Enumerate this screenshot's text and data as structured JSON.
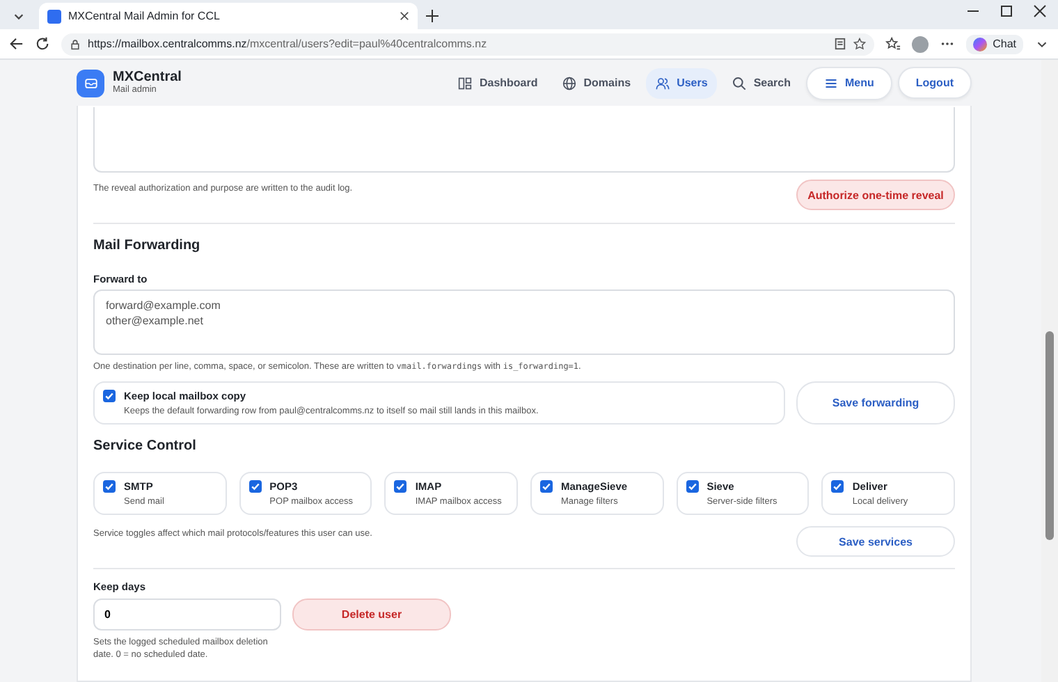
{
  "browser": {
    "tab_title": "MXCentral Mail Admin for CCL",
    "url_host": "https://mailbox.centralcomms.nz",
    "url_path": "/mxcentral/users?edit=paul%40centralcomms.nz",
    "chat_label": "Chat"
  },
  "app": {
    "brand": "MXCentral",
    "subtitle": "Mail admin"
  },
  "nav": [
    {
      "label": "Dashboard",
      "kind": "dashboard",
      "selected": false
    },
    {
      "label": "Domains",
      "kind": "domains",
      "selected": false
    },
    {
      "label": "Users",
      "kind": "users",
      "selected": true
    },
    {
      "label": "Search",
      "kind": "search",
      "selected": false
    }
  ],
  "header_buttons": [
    {
      "label": "Menu",
      "kind": "menu"
    },
    {
      "label": "Logout",
      "kind": "logout"
    }
  ],
  "reveal": {
    "note": "The reveal authorization and purpose are written to the audit log.",
    "button": "Authorize one-time reveal"
  },
  "forwarding": {
    "heading": "Mail Forwarding",
    "label": "Forward to",
    "value": "forward@example.com\nother@example.net",
    "hint": [
      {
        "kind": "text",
        "text": "One destination per line, comma, space, or semicolon. These are written to "
      },
      {
        "kind": "code",
        "text": "vmail.forwardings"
      },
      {
        "kind": "text",
        "text": " with "
      },
      {
        "kind": "code",
        "text": "is_forwarding=1"
      },
      {
        "kind": "text",
        "text": "."
      }
    ],
    "keep_copy": {
      "label": "Keep local mailbox copy",
      "description": "Keeps the default forwarding row from paul@centralcomms.nz to itself so mail still lands in this mailbox.",
      "checked": true
    },
    "button": "Save forwarding"
  },
  "services": {
    "heading": "Service Control",
    "items": [
      {
        "name": "SMTP",
        "description": "Send mail",
        "checked": true
      },
      {
        "name": "POP3",
        "description": "POP mailbox access",
        "checked": true
      },
      {
        "name": "IMAP",
        "description": "IMAP mailbox access",
        "checked": true
      },
      {
        "name": "ManageSieve",
        "description": "Manage filters",
        "checked": true
      },
      {
        "name": "Sieve",
        "description": "Server-side filters",
        "checked": true
      },
      {
        "name": "Deliver",
        "description": "Local delivery",
        "checked": true
      }
    ],
    "note": "Service toggles affect which mail protocols/features this user can use.",
    "button": "Save services"
  },
  "deletion": {
    "label": "Keep days",
    "value": "0",
    "note": "Sets the logged scheduled mailbox deletion date. 0 = no scheduled date.",
    "button": "Delete user"
  }
}
